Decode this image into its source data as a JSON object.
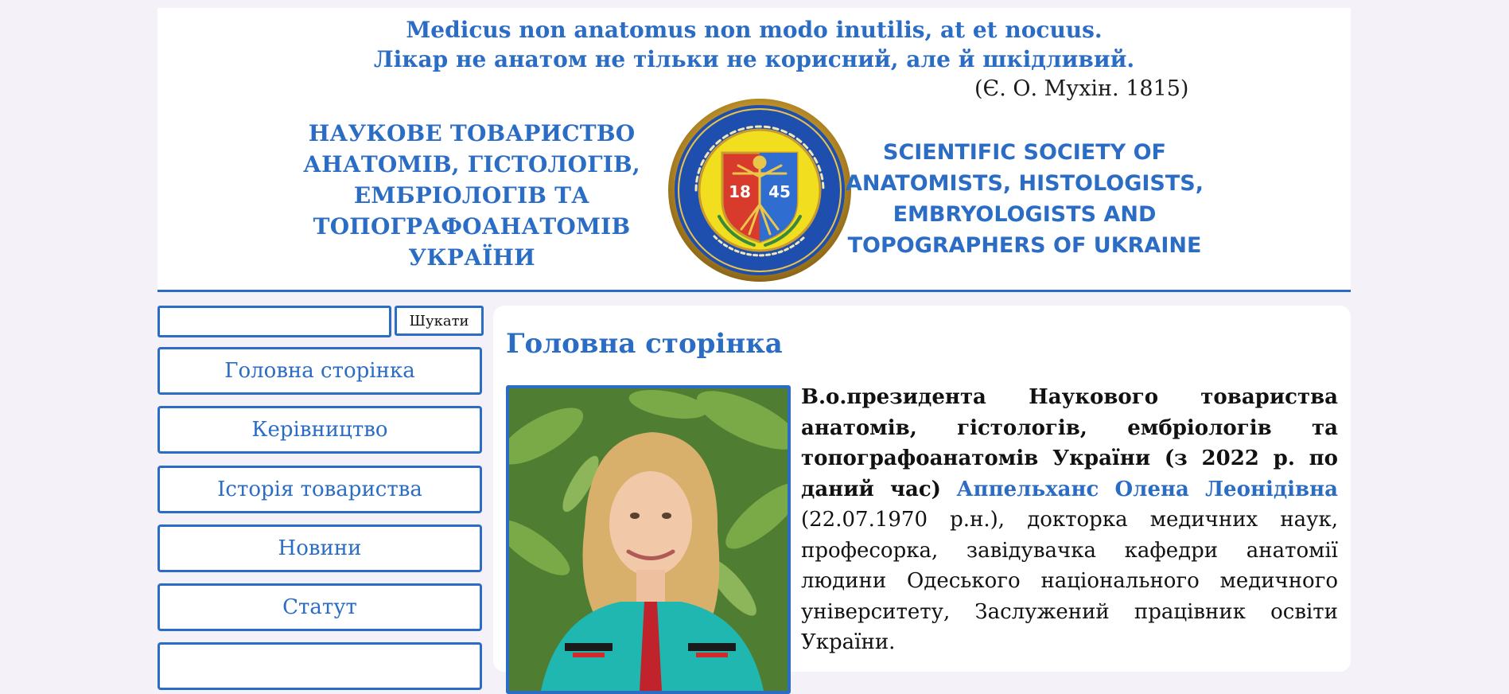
{
  "header": {
    "motto_latin": "Medicus non anatomus non modo inutilis, at et nocuus.",
    "motto_ukrainian": "Лікар не анатом не тільки не корисний, але й шкідливий.",
    "motto_author": "(Є. О. Мухін. 1815)",
    "title_ua_lines": [
      "НАУКОВЕ ТОВАРИСТВО",
      "АНАТОМІВ, ГІСТОЛОГІВ,",
      "ЕМБРІОЛОГІВ ТА",
      "ТОПОГРАФОАНАТОМІВ",
      "УКРАЇНИ"
    ],
    "title_en_lines": [
      "SCIENTIFIC SOCIETY OF",
      "ANATOMISTS, HISTOLOGISTS,",
      "EMBRYOLOGISTS AND",
      "TOPOGRAPHERS OF UKRAINE"
    ],
    "emblem_years": [
      "18",
      "45"
    ],
    "accent_color": "#2b6cc4"
  },
  "search": {
    "value": "",
    "button_label": "Шукати"
  },
  "sidebar": {
    "items": [
      {
        "label": "Головна сторінка"
      },
      {
        "label": "Керівництво"
      },
      {
        "label": "Історія товариства"
      },
      {
        "label": "Новини"
      },
      {
        "label": "Статут"
      },
      {
        "label": ""
      }
    ]
  },
  "main": {
    "page_title": "Головна сторінка",
    "bio_role": "В.о.президента Наукового товариства анатомів, гістологів, ембріологів та топографоанатомів України (з 2022 р. по даний час)",
    "bio_name": "Аппельханс Олена Леонідівна",
    "bio_details": "(22.07.1970 р.н.), докторка медичних наук, професорка, завідувачка кафедри анатомії людини Одеського національного медичного університету, Заслужений працівник освіти України."
  }
}
